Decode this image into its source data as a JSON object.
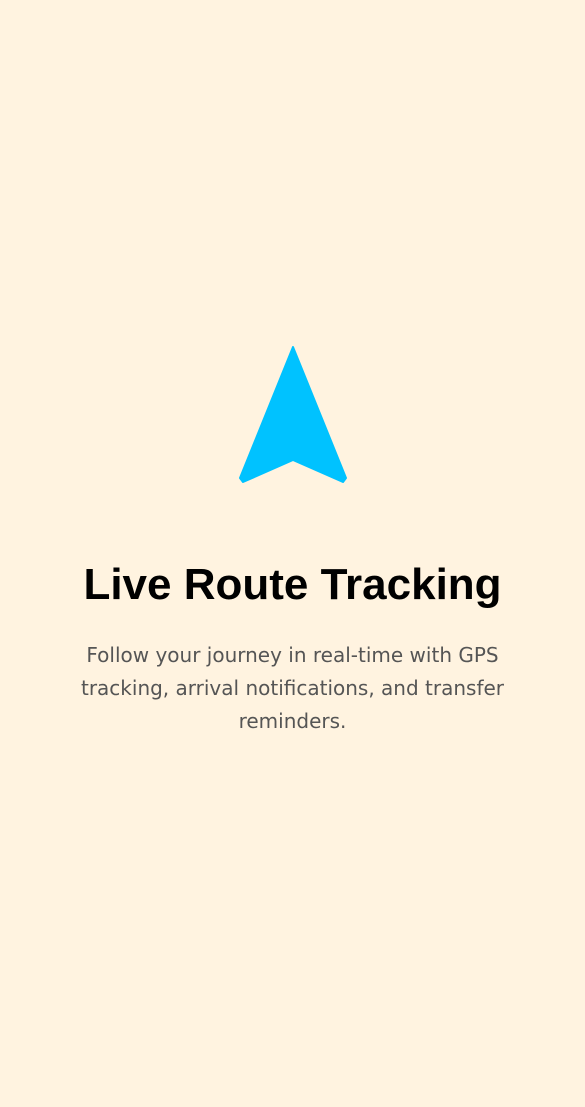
{
  "onboarding": {
    "icon": "navigation-arrow-icon",
    "icon_color": "#00C2FF",
    "background_color": "#FFF3E0",
    "title": "Live Route Tracking",
    "description": "Follow your journey in real-time with GPS tracking, arrival notifications, and transfer reminders."
  }
}
